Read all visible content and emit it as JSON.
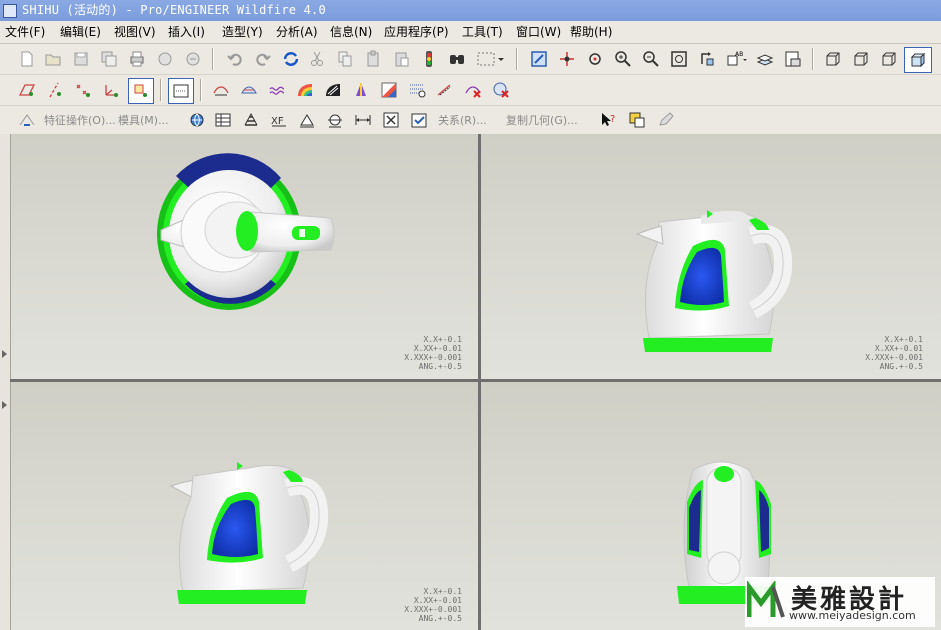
{
  "window": {
    "title": "SHIHU (活动的) - Pro/ENGINEER Wildfire 4.0"
  },
  "menu": [
    "文件(F)",
    "编辑(E)",
    "视图(V)",
    "插入(I)",
    "造型(Y)",
    "分析(A)",
    "信息(N)",
    "应用程序(P)",
    "工具(T)",
    "窗口(W)",
    "帮助(H)"
  ],
  "toolbar3": {
    "feature_ops": "特征操作(O)...",
    "molds": "模具(M)...",
    "relations": "关系(R)...",
    "copy_geom": "复制几何(G)..."
  },
  "tolerance": [
    "X.X+-0.1",
    "X.XX+-0.01",
    "X.XXX+-0.001",
    "ANG.+-0.5"
  ],
  "watermark": {
    "brand": "美雅設計",
    "url": "www.meiyadesign.com"
  },
  "colors": {
    "accent": "#22ee22",
    "glass": "#1a3ecf",
    "body": "#ffffff",
    "title": "#7b9cdc"
  }
}
